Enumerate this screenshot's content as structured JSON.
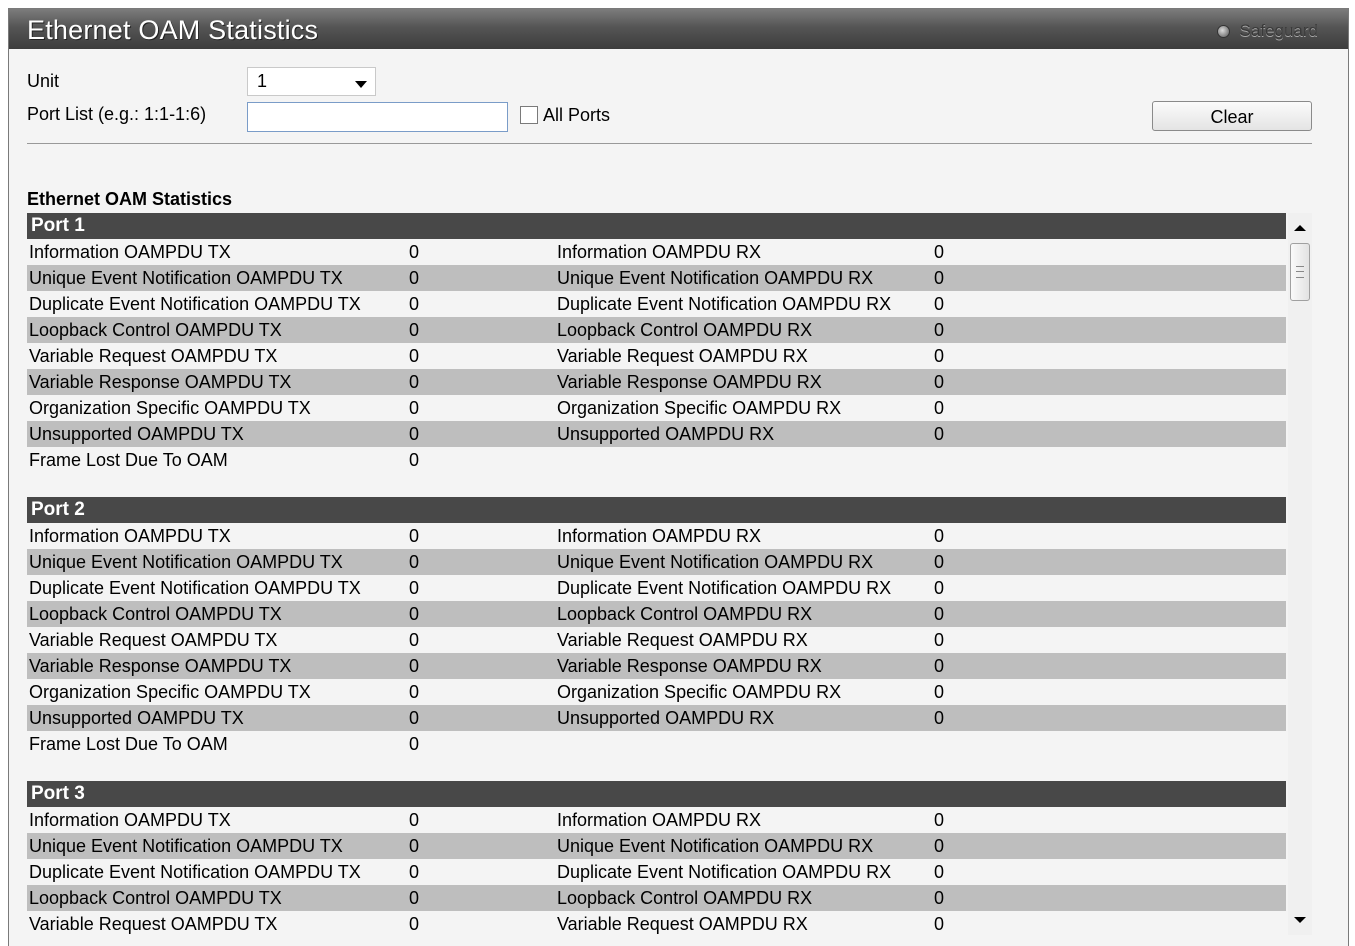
{
  "window": {
    "title": "Ethernet OAM Statistics",
    "safeguard_label": "Safeguard"
  },
  "form": {
    "unit_label": "Unit",
    "unit_value": "1",
    "port_list_label": "Port List (e.g.: 1:1-1:6)",
    "port_list_value": "",
    "all_ports_label": "All Ports",
    "all_ports_checked": false,
    "clear_label": "Clear"
  },
  "section_title": "Ethernet OAM Statistics",
  "ports": [
    {
      "name": "Port 1",
      "rows": [
        {
          "tx_label": "Information OAMPDU TX",
          "tx_value": "0",
          "rx_label": "Information OAMPDU RX",
          "rx_value": "0"
        },
        {
          "tx_label": "Unique Event Notification OAMPDU TX",
          "tx_value": "0",
          "rx_label": "Unique Event Notification OAMPDU RX",
          "rx_value": "0"
        },
        {
          "tx_label": "Duplicate Event Notification OAMPDU TX",
          "tx_value": "0",
          "rx_label": "Duplicate Event Notification OAMPDU RX",
          "rx_value": "0"
        },
        {
          "tx_label": "Loopback Control OAMPDU TX",
          "tx_value": "0",
          "rx_label": "Loopback Control OAMPDU RX",
          "rx_value": "0"
        },
        {
          "tx_label": "Variable Request OAMPDU TX",
          "tx_value": "0",
          "rx_label": "Variable Request OAMPDU RX",
          "rx_value": "0"
        },
        {
          "tx_label": "Variable Response OAMPDU TX",
          "tx_value": "0",
          "rx_label": "Variable Response OAMPDU RX",
          "rx_value": "0"
        },
        {
          "tx_label": "Organization Specific OAMPDU TX",
          "tx_value": "0",
          "rx_label": "Organization Specific OAMPDU RX",
          "rx_value": "0"
        },
        {
          "tx_label": "Unsupported OAMPDU TX",
          "tx_value": "0",
          "rx_label": "Unsupported OAMPDU RX",
          "rx_value": "0"
        },
        {
          "tx_label": "Frame Lost Due To OAM",
          "tx_value": "0",
          "rx_label": "",
          "rx_value": ""
        }
      ]
    },
    {
      "name": "Port 2",
      "rows": [
        {
          "tx_label": "Information OAMPDU TX",
          "tx_value": "0",
          "rx_label": "Information OAMPDU RX",
          "rx_value": "0"
        },
        {
          "tx_label": "Unique Event Notification OAMPDU TX",
          "tx_value": "0",
          "rx_label": "Unique Event Notification OAMPDU RX",
          "rx_value": "0"
        },
        {
          "tx_label": "Duplicate Event Notification OAMPDU TX",
          "tx_value": "0",
          "rx_label": "Duplicate Event Notification OAMPDU RX",
          "rx_value": "0"
        },
        {
          "tx_label": "Loopback Control OAMPDU TX",
          "tx_value": "0",
          "rx_label": "Loopback Control OAMPDU RX",
          "rx_value": "0"
        },
        {
          "tx_label": "Variable Request OAMPDU TX",
          "tx_value": "0",
          "rx_label": "Variable Request OAMPDU RX",
          "rx_value": "0"
        },
        {
          "tx_label": "Variable Response OAMPDU TX",
          "tx_value": "0",
          "rx_label": "Variable Response OAMPDU RX",
          "rx_value": "0"
        },
        {
          "tx_label": "Organization Specific OAMPDU TX",
          "tx_value": "0",
          "rx_label": "Organization Specific OAMPDU RX",
          "rx_value": "0"
        },
        {
          "tx_label": "Unsupported OAMPDU TX",
          "tx_value": "0",
          "rx_label": "Unsupported OAMPDU RX",
          "rx_value": "0"
        },
        {
          "tx_label": "Frame Lost Due To OAM",
          "tx_value": "0",
          "rx_label": "",
          "rx_value": ""
        }
      ]
    },
    {
      "name": "Port 3",
      "rows": [
        {
          "tx_label": "Information OAMPDU TX",
          "tx_value": "0",
          "rx_label": "Information OAMPDU RX",
          "rx_value": "0"
        },
        {
          "tx_label": "Unique Event Notification OAMPDU TX",
          "tx_value": "0",
          "rx_label": "Unique Event Notification OAMPDU RX",
          "rx_value": "0"
        },
        {
          "tx_label": "Duplicate Event Notification OAMPDU TX",
          "tx_value": "0",
          "rx_label": "Duplicate Event Notification OAMPDU RX",
          "rx_value": "0"
        },
        {
          "tx_label": "Loopback Control OAMPDU TX",
          "tx_value": "0",
          "rx_label": "Loopback Control OAMPDU RX",
          "rx_value": "0"
        },
        {
          "tx_label": "Variable Request OAMPDU TX",
          "tx_value": "0",
          "rx_label": "Variable Request OAMPDU RX",
          "rx_value": "0"
        }
      ]
    }
  ]
}
